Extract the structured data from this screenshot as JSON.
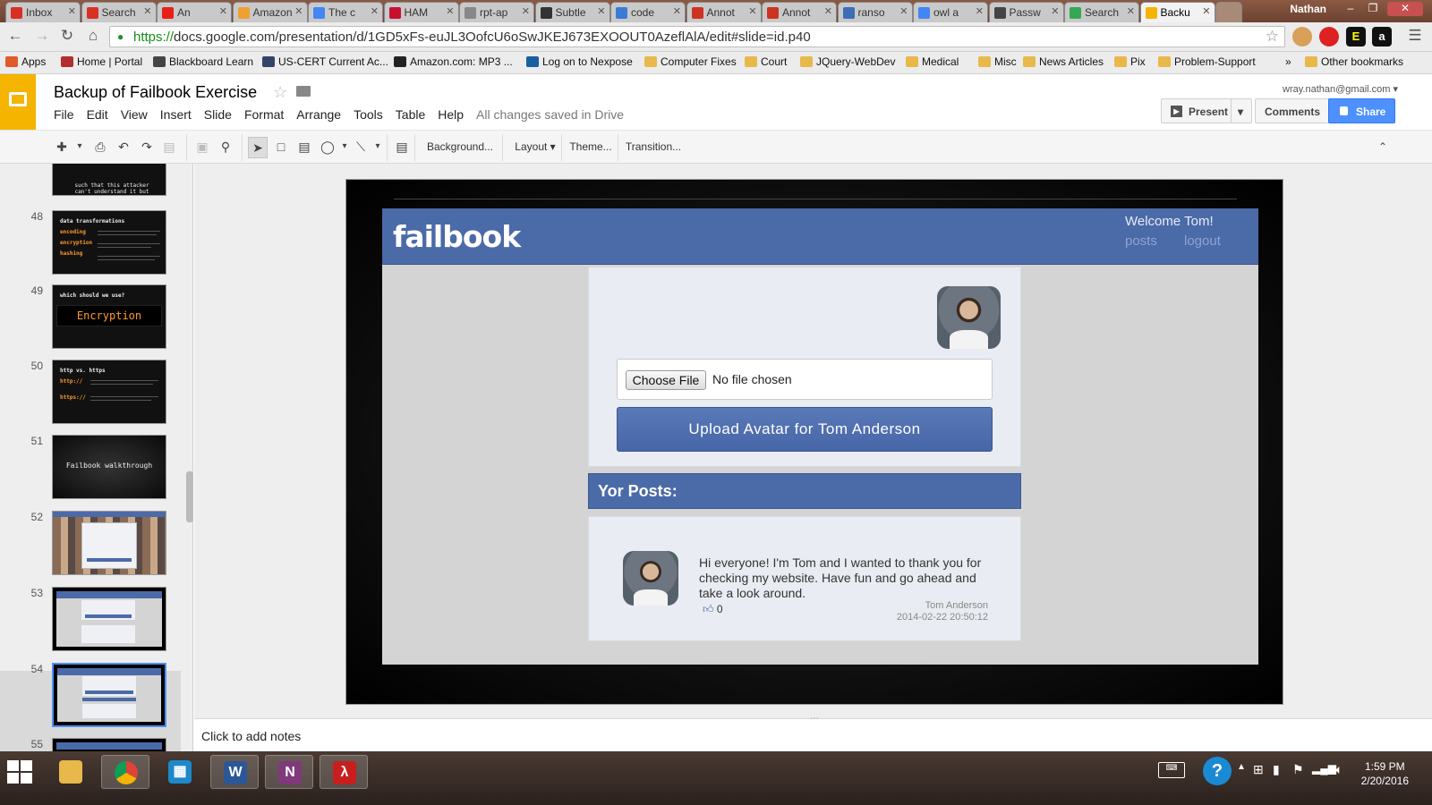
{
  "browser": {
    "tabs": [
      {
        "label": "Inbox",
        "color": "#d93025"
      },
      {
        "label": "Search",
        "color": "#d93025"
      },
      {
        "label": "An",
        "color": "#e62117"
      },
      {
        "label": "Amazon",
        "color": "#f0a030"
      },
      {
        "label": "The c",
        "color": "#4285f4"
      },
      {
        "label": "HAM",
        "color": "#c8102e"
      },
      {
        "label": "rpt-ap",
        "color": "#888888"
      },
      {
        "label": "Subtle",
        "color": "#333333"
      },
      {
        "label": "code",
        "color": "#3b7bd8"
      },
      {
        "label": "Annot",
        "color": "#cc3322"
      },
      {
        "label": "Annot",
        "color": "#cc3322"
      },
      {
        "label": "ranso",
        "color": "#3d6db5"
      },
      {
        "label": "owl a",
        "color": "#4285f4"
      },
      {
        "label": "Passw",
        "color": "#444444"
      },
      {
        "label": "Search",
        "color": "#34a853"
      },
      {
        "label": "Backu",
        "color": "#f4b400"
      }
    ],
    "user": "Nathan",
    "url_scheme": "https://",
    "url_rest": "docs.google.com/presentation/d/1GD5xFs-euJL3OofcU6oSwJKEJ673EXOOUT0AzeflAlA/edit#slide=id.p40",
    "bookmarks": [
      {
        "label": "Apps",
        "icon": "apps-grid",
        "color": "#e05a2a"
      },
      {
        "label": "Home | Portal",
        "icon": "shield",
        "color": "#b03030"
      },
      {
        "label": "Blackboard Learn",
        "icon": "blackboard",
        "color": "#444444"
      },
      {
        "label": "US-CERT Current Ac...",
        "icon": "us-cert",
        "color": "#334466"
      },
      {
        "label": "Amazon.com: MP3 ...",
        "icon": "amazon",
        "color": "#222222"
      },
      {
        "label": "Log on to Nexpose",
        "icon": "nexpose",
        "color": "#1a5fa0"
      },
      {
        "label": "Computer Fixes",
        "icon": "folder",
        "color": "#e8b84a"
      },
      {
        "label": "Court",
        "icon": "folder",
        "color": "#e8b84a"
      },
      {
        "label": "JQuery-WebDev",
        "icon": "folder",
        "color": "#e8b84a"
      },
      {
        "label": "Medical",
        "icon": "folder",
        "color": "#e8b84a"
      },
      {
        "label": "Misc",
        "icon": "folder",
        "color": "#e8b84a"
      },
      {
        "label": "News Articles",
        "icon": "folder",
        "color": "#e8b84a"
      },
      {
        "label": "Pix",
        "icon": "folder",
        "color": "#e8b84a"
      },
      {
        "label": "Problem-Support",
        "icon": "folder",
        "color": "#e8b84a"
      }
    ],
    "bookmarks_overflow": "»",
    "other_bookmarks": "Other bookmarks"
  },
  "docs": {
    "title": "Backup of Failbook Exercise",
    "menu": [
      "File",
      "Edit",
      "View",
      "Insert",
      "Slide",
      "Format",
      "Arrange",
      "Tools",
      "Table",
      "Help"
    ],
    "save_status": "All changes saved in Drive",
    "account": "wray.nathan@gmail.com",
    "present": "Present",
    "comments": "Comments",
    "share": "Share",
    "toolbar": {
      "background": "Background...",
      "layout": "Layout",
      "theme": "Theme...",
      "transition": "Transition..."
    },
    "notes_placeholder": "Click to add notes"
  },
  "filmstrip": {
    "partial_top_text": "such that this attacker can't understand it but failbook can",
    "slides": [
      {
        "num": "48",
        "title": "data transformations",
        "items": [
          "encoding",
          "encryption",
          "hashing"
        ]
      },
      {
        "num": "49",
        "title": "which should we use?",
        "big": "Encryption"
      },
      {
        "num": "50",
        "title": "http vs. https",
        "items": [
          "http://",
          "https://"
        ]
      },
      {
        "num": "51",
        "center": "Failbook walkthrough"
      },
      {
        "num": "52"
      },
      {
        "num": "53"
      },
      {
        "num": "54",
        "selected": true
      },
      {
        "num": "55"
      }
    ]
  },
  "failbook": {
    "logo": "failbook",
    "welcome": "Welcome Tom!",
    "nav": [
      "posts",
      "logout"
    ],
    "choose_file": "Choose File",
    "no_file": "No file chosen",
    "upload_button": "Upload Avatar for Tom Anderson",
    "posts_header": "Yor Posts:",
    "post": {
      "text": "Hi everyone! I'm Tom and I wanted to thank you for checking my website. Have fun and go ahead and take a look around.",
      "likes": "0",
      "author": "Tom Anderson",
      "date": "2014-02-22 20:50:12"
    }
  },
  "taskbar": {
    "apps": [
      "file-explorer",
      "chrome",
      "outlook-calendar",
      "word",
      "onenote",
      "acrobat"
    ],
    "time": "1:59 PM",
    "date": "2/20/2016"
  }
}
